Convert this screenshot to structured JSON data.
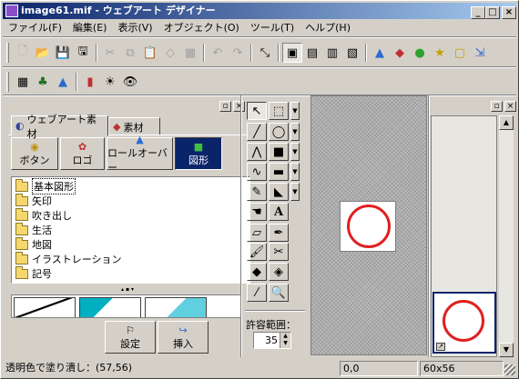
{
  "window": {
    "title": "image61.mif - ウェブアート デザイナー",
    "minimize": "_",
    "maximize": "□",
    "close": "×"
  },
  "menu": [
    "ファイル(F)",
    "編集(E)",
    "表示(V)",
    "オブジェクト(O)",
    "ツール(T)",
    "ヘルプ(H)"
  ],
  "toolbar1": [
    "new",
    "open",
    "save",
    "save-as",
    "cut",
    "copy",
    "paste",
    "clear",
    "grid",
    "undo",
    "redo",
    "resize",
    "layer1",
    "layer2",
    "layer3",
    "layer4",
    "scene",
    "stack",
    "group",
    "photo",
    "frame",
    "export"
  ],
  "panel": {
    "tabs": [
      "ウェブアート素材",
      "素材"
    ],
    "categories": [
      "ボタン",
      "ロゴ",
      "ロールオーバー",
      "図形"
    ],
    "items": [
      "基本図形",
      "矢印",
      "吹き出し",
      "生活",
      "地図",
      "イラストレーション",
      "記号"
    ],
    "settings_label": "設定",
    "insert_label": "挿入",
    "float_btn": "▫",
    "close_btn": "×"
  },
  "tolerance": {
    "label": "許容範囲：",
    "value": "35"
  },
  "status": {
    "left": "透明色で塗り潰し：(57,56)",
    "coords": "0,0",
    "size": "60x56"
  },
  "colors": {
    "title_start": "#0a246a",
    "title_end": "#a6caf0",
    "circle": "#e02020"
  }
}
